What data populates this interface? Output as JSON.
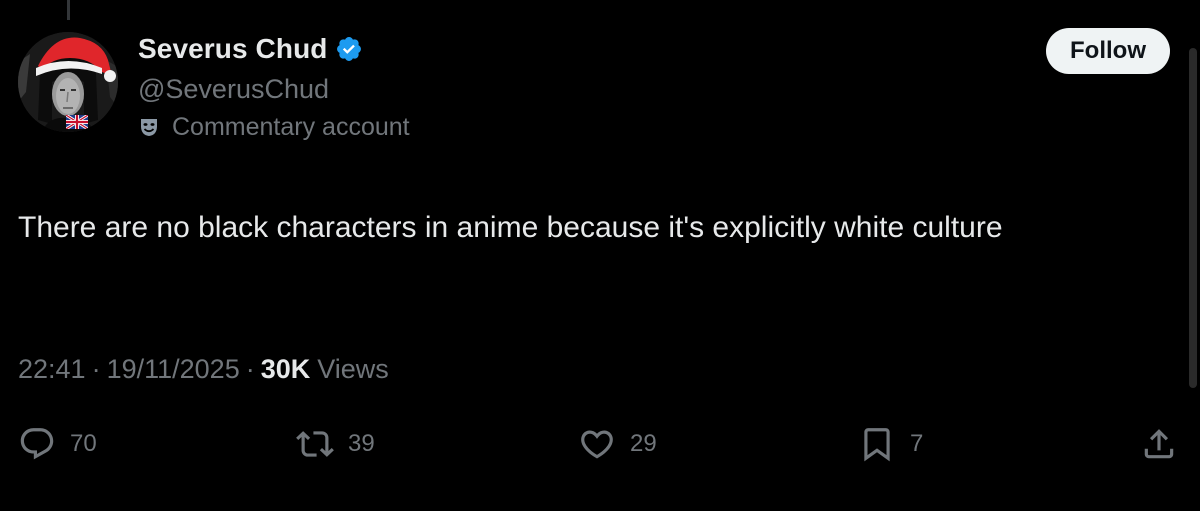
{
  "author": {
    "display_name": "Severus Chud",
    "handle": "@SeverusChud",
    "label": "Commentary account",
    "verified": true,
    "verified_color": "#1d9bf0"
  },
  "follow_button": {
    "label": "Follow"
  },
  "tweet": {
    "text": "There are no black characters in anime because it's explicitly white culture"
  },
  "meta": {
    "time": "22:41",
    "separator": "·",
    "date": "19/11/2025",
    "views_count": "30K",
    "views_label": "Views"
  },
  "actions": {
    "replies": "70",
    "reposts": "39",
    "likes": "29",
    "bookmarks": "7"
  },
  "icons": {
    "avatar": "avatar-santa-hat",
    "verified": "verified-badge-icon",
    "label": "theater-mask-icon",
    "reply": "reply-icon",
    "repost": "repost-icon",
    "like": "heart-icon",
    "bookmark": "bookmark-icon",
    "share": "share-icon"
  },
  "colors": {
    "background": "#000000",
    "primary_text": "#e7e9ea",
    "secondary_text": "#71767b",
    "follow_bg": "#eff3f4",
    "hat_red": "#e0262b"
  }
}
